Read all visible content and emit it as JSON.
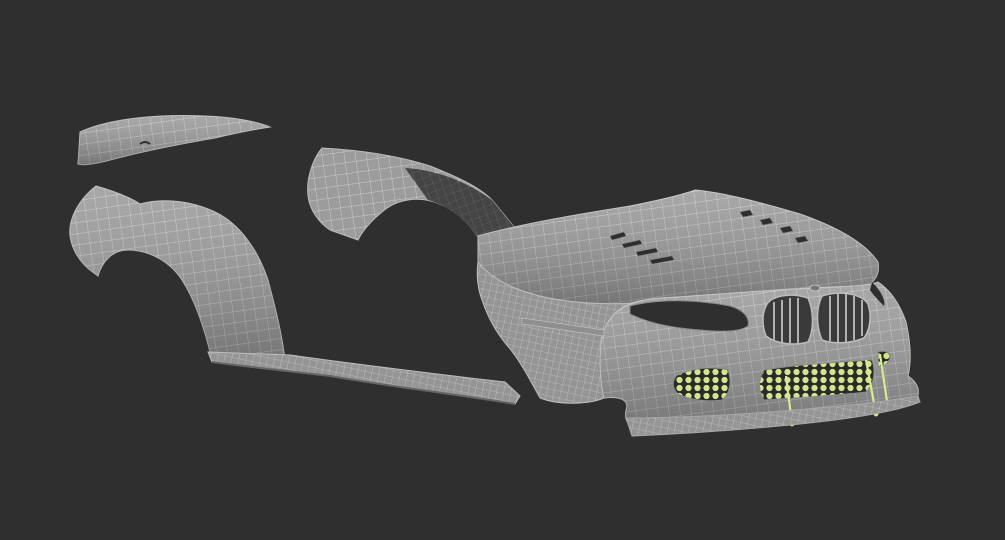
{
  "scene": {
    "background_color": "#2f2f2f",
    "mesh_fill_color": "#9c9c9c",
    "mesh_shadow_color": "#5e5e5e",
    "wire_color": "#d9d9d9",
    "dark_part_color": "#1c1c1c",
    "mesh_grille_color": "#cfe58a",
    "strut_color": "#d7ec8f",
    "parts": [
      "rear-wing-icon",
      "rear-fender-icon",
      "side-skirt-icon",
      "front-fender-icon",
      "hood-icon",
      "front-bumper-icon",
      "kidney-grille-icon",
      "headlight-icon",
      "brake-vent-icon",
      "splitter-icon"
    ]
  }
}
